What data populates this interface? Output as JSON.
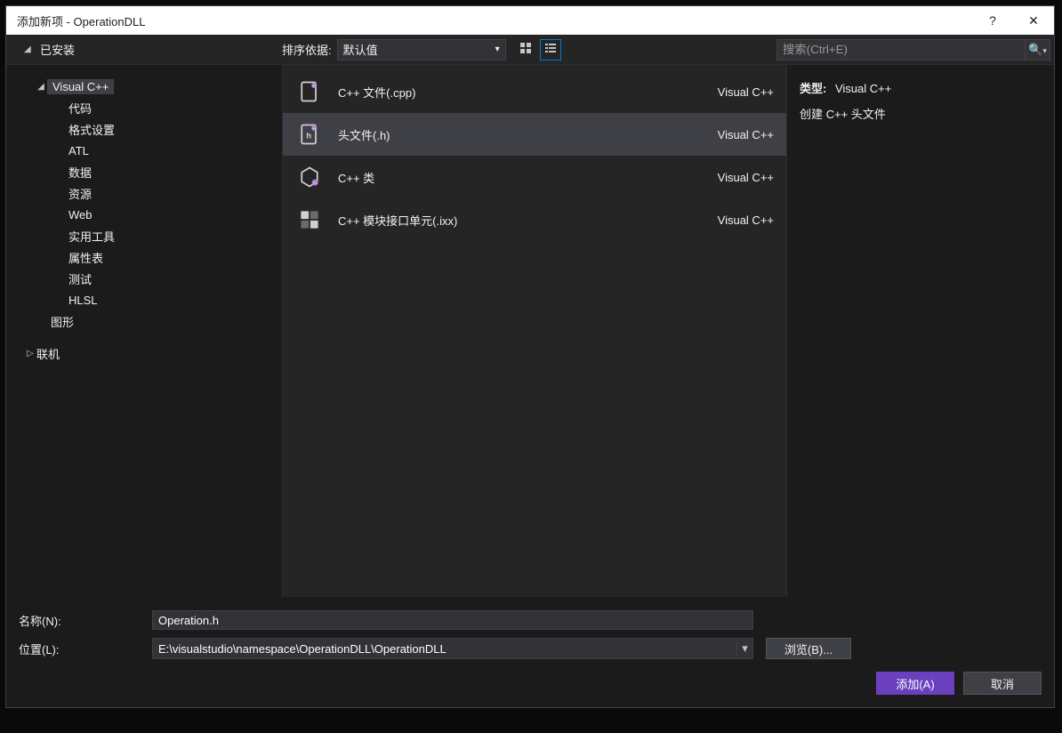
{
  "titlebar": {
    "title": "添加新项 - OperationDLL"
  },
  "toprow": {
    "installed": "已安装",
    "sort_label": "排序依据:",
    "sort_value": "默认值",
    "search_placeholder": "搜索(Ctrl+E)"
  },
  "sidebar": {
    "visual_cpp": "Visual C++",
    "items": [
      "代码",
      "格式设置",
      "ATL",
      "数据",
      "资源",
      "Web",
      "实用工具",
      "属性表",
      "测试",
      "HLSL"
    ],
    "graphics": "图形",
    "online": "联机"
  },
  "templates": [
    {
      "name": "C++ 文件(.cpp)",
      "lang": "Visual C++"
    },
    {
      "name": "头文件(.h)",
      "lang": "Visual C++"
    },
    {
      "name": "C++ 类",
      "lang": "Visual C++"
    },
    {
      "name": "C++ 模块接口单元(.ixx)",
      "lang": "Visual C++"
    }
  ],
  "detail": {
    "type_label": "类型:",
    "type_value": "Visual C++",
    "desc": "创建 C++ 头文件"
  },
  "form": {
    "name_label": "名称(N):",
    "name_value": "Operation.h",
    "location_label": "位置(L):",
    "location_value": "E:\\visualstudio\\namespace\\OperationDLL\\OperationDLL",
    "browse": "浏览(B)..."
  },
  "footer": {
    "add": "添加(A)",
    "cancel": "取消"
  }
}
